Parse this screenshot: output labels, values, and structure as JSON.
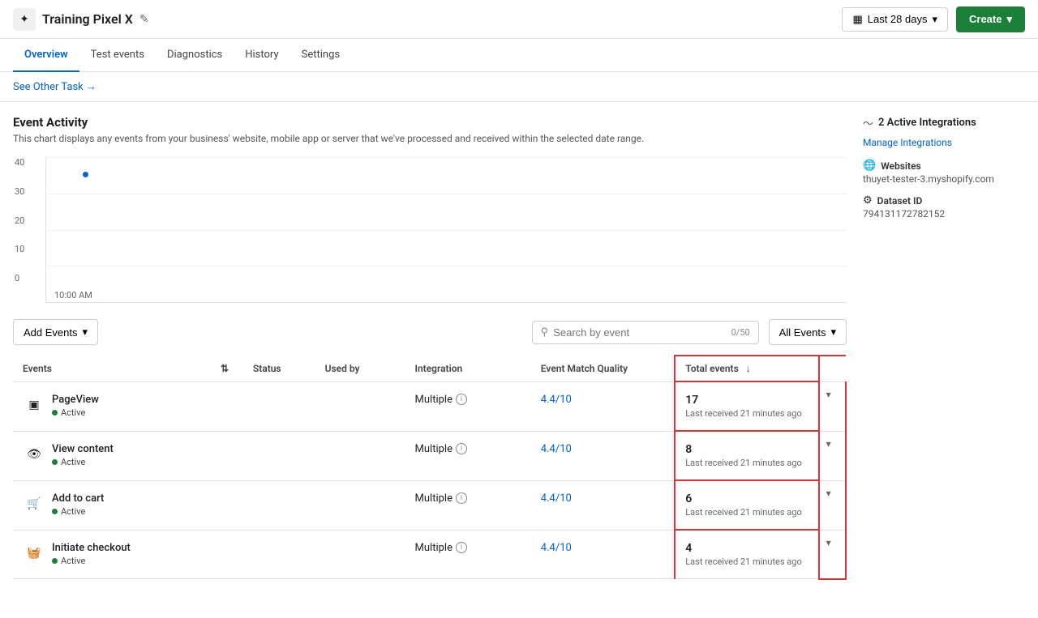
{
  "header": {
    "title": "Training Pixel X",
    "edit_icon": "✎",
    "date_range": "Last 28 days",
    "create_label": "Create"
  },
  "nav": {
    "tabs": [
      {
        "id": "overview",
        "label": "Overview",
        "active": true
      },
      {
        "id": "test-events",
        "label": "Test events",
        "active": false
      },
      {
        "id": "diagnostics",
        "label": "Diagnostics",
        "active": false
      },
      {
        "id": "history",
        "label": "History",
        "active": false
      },
      {
        "id": "settings",
        "label": "Settings",
        "active": false
      }
    ]
  },
  "sub_header": {
    "link_text": "See Other Task →"
  },
  "event_activity": {
    "title": "Event Activity",
    "description": "This chart displays any events from your business' website, mobile app or server that we've processed and received within the selected date range.",
    "chart": {
      "y_labels": [
        "40",
        "30",
        "20",
        "10",
        "0"
      ],
      "x_label": "10:00 AM"
    }
  },
  "right_panel": {
    "integrations_count": "2 Active Integrations",
    "manage_link": "Manage Integrations",
    "websites_label": "Websites",
    "websites_value": "thuyet-tester-3.myshopify.com",
    "dataset_label": "Dataset ID",
    "dataset_value": "794131172782152"
  },
  "toolbar": {
    "add_events_label": "Add Events",
    "search_placeholder": "Search by event",
    "search_count": "0/50",
    "all_events_label": "All Events"
  },
  "table": {
    "columns": [
      {
        "id": "events",
        "label": "Events"
      },
      {
        "id": "sort",
        "label": ""
      },
      {
        "id": "status",
        "label": "Status"
      },
      {
        "id": "usedby",
        "label": "Used by"
      },
      {
        "id": "integration",
        "label": "Integration"
      },
      {
        "id": "match",
        "label": "Event Match Quality"
      },
      {
        "id": "total",
        "label": "Total events"
      }
    ],
    "rows": [
      {
        "icon": "□",
        "name": "PageView",
        "status": "Active",
        "used_by": "",
        "integration": "Multiple",
        "match_quality": "4.4/10",
        "total_count": "17",
        "total_sub": "Last received 21 minutes ago"
      },
      {
        "icon": "👁",
        "name": "View content",
        "status": "Active",
        "used_by": "",
        "integration": "Multiple",
        "match_quality": "4.4/10",
        "total_count": "8",
        "total_sub": "Last received 21 minutes ago"
      },
      {
        "icon": "🛒",
        "name": "Add to cart",
        "status": "Active",
        "used_by": "",
        "integration": "Multiple",
        "match_quality": "4.4/10",
        "total_count": "6",
        "total_sub": "Last received 21 minutes ago"
      },
      {
        "icon": "🧺",
        "name": "Initiate checkout",
        "status": "Active",
        "used_by": "",
        "integration": "Multiple",
        "match_quality": "4.4/10",
        "total_count": "4",
        "total_sub": "Last received 21 minutes ago"
      }
    ]
  }
}
